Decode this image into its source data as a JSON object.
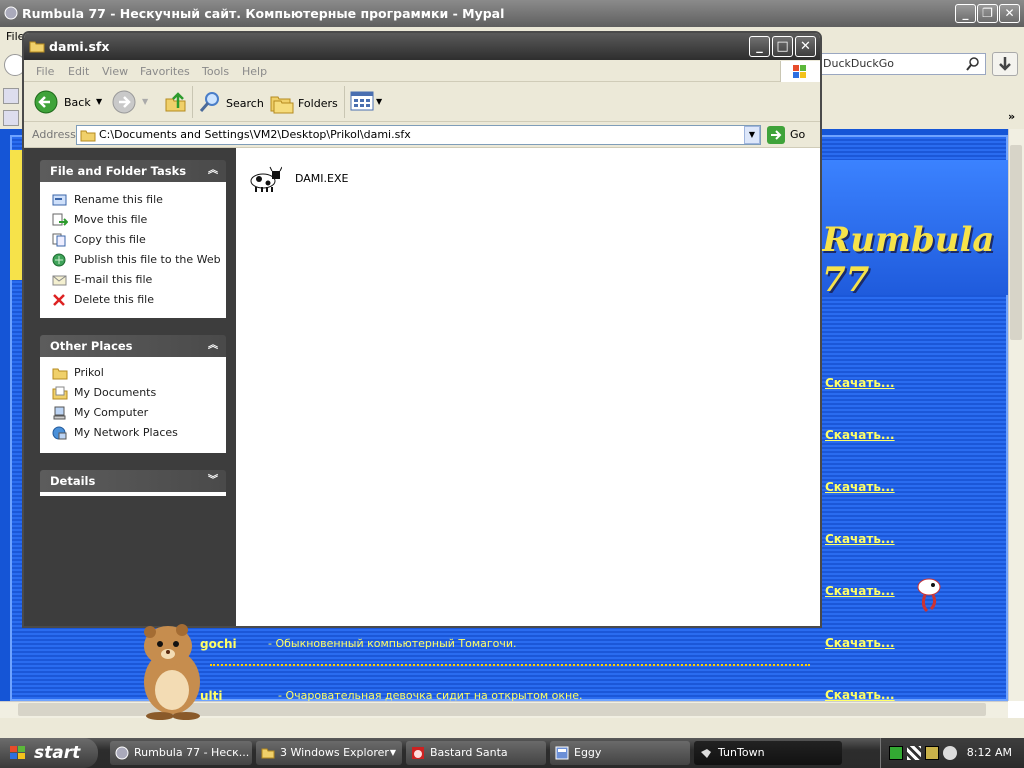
{
  "browser": {
    "title": "Rumbula 77 - Нескучный сайт. Компьютерные программки - Mypal",
    "menu_first": "File",
    "search_placeholder": "DuckDuckGo",
    "site": {
      "logo": "Rumbula 77",
      "download_label": "Скачать...",
      "rows": [
        {
          "name": "gochi",
          "desc": "- Обыкновенный компьютерный Томагочи."
        },
        {
          "name": "ulti",
          "desc": "- Очаровательная девочка сидит на открытом окне."
        }
      ]
    }
  },
  "explorer": {
    "title": "dami.sfx",
    "menu": [
      "File",
      "Edit",
      "View",
      "Favorites",
      "Tools",
      "Help"
    ],
    "toolbar": {
      "back": "Back",
      "search": "Search",
      "folders": "Folders"
    },
    "address_label": "Address",
    "address_value": "C:\\Documents and Settings\\VM2\\Desktop\\Prikol\\dami.sfx",
    "go_label": "Go",
    "panels": {
      "file_tasks": {
        "title": "File and Folder Tasks",
        "items": [
          {
            "label": "Rename this file",
            "icon": "rename-icon"
          },
          {
            "label": "Move this file",
            "icon": "move-icon"
          },
          {
            "label": "Copy this file",
            "icon": "copy-icon"
          },
          {
            "label": "Publish this file to the Web",
            "icon": "publish-web-icon"
          },
          {
            "label": "E-mail this file",
            "icon": "email-icon"
          },
          {
            "label": "Delete this file",
            "icon": "delete-icon"
          }
        ]
      },
      "other_places": {
        "title": "Other Places",
        "items": [
          {
            "label": "Prikol",
            "icon": "folder-icon"
          },
          {
            "label": "My Documents",
            "icon": "my-documents-icon"
          },
          {
            "label": "My Computer",
            "icon": "my-computer-icon"
          },
          {
            "label": "My Network Places",
            "icon": "network-places-icon"
          }
        ]
      },
      "details": {
        "title": "Details"
      }
    },
    "file": {
      "name": "DAMI.EXE"
    }
  },
  "taskbar": {
    "start_label": "start",
    "items": [
      {
        "label": "Rumbula 77 - Неск...",
        "icon": "browser-icon"
      },
      {
        "label": "3 Windows Explorer",
        "icon": "folder-icon"
      },
      {
        "label": "Bastard Santa",
        "icon": "santa-icon"
      },
      {
        "label": "Eggy",
        "icon": "eggy-icon"
      },
      {
        "label": "TunTown",
        "icon": "tuntown-icon"
      }
    ],
    "clock": "8:12 AM"
  },
  "colors": {
    "site_blue": "#1555d6",
    "link_yellow": "#ffff66",
    "xp_panel_dark": "#3d3d3d"
  }
}
